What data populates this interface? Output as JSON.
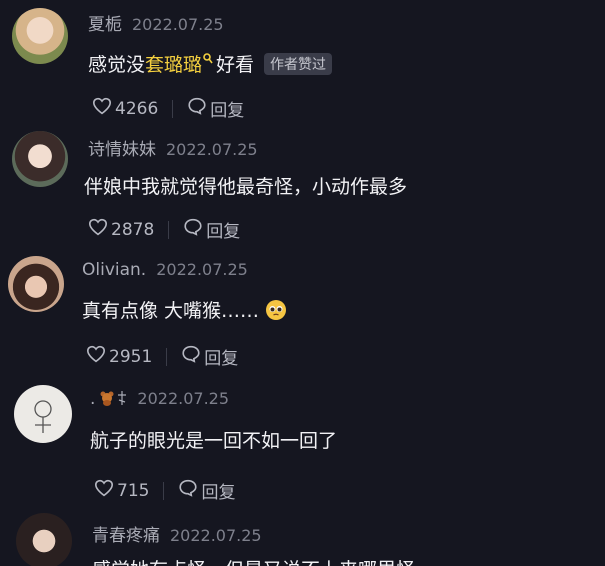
{
  "comments": [
    {
      "name": "夏栀",
      "date": "2022.07.25",
      "text_before": "感觉没",
      "keyword": "套璐璐",
      "text_after": "好看",
      "badge": "作者赞过",
      "likes": "4266",
      "reply": "回复"
    },
    {
      "name": "诗情妹妹",
      "date": "2022.07.25",
      "text": "伴娘中我就觉得他最奇怪，小动作最多",
      "likes": "2878",
      "reply": "回复"
    },
    {
      "name": "Olivian.",
      "date": "2022.07.25",
      "text": "真有点像 大嘴猴……",
      "likes": "2951",
      "reply": "回复"
    },
    {
      "name": ".",
      "date": "2022.07.25",
      "text": "航子的眼光是一回不如一回了",
      "likes": "715",
      "reply": "回复"
    },
    {
      "name": "青春疼痛",
      "date": "2022.07.25",
      "text": "感觉她有点怪，但是又说不上来哪里怪"
    }
  ],
  "colors": {
    "background": "#151620",
    "keyword": "#f4d03f",
    "muted": "#7e808c"
  }
}
